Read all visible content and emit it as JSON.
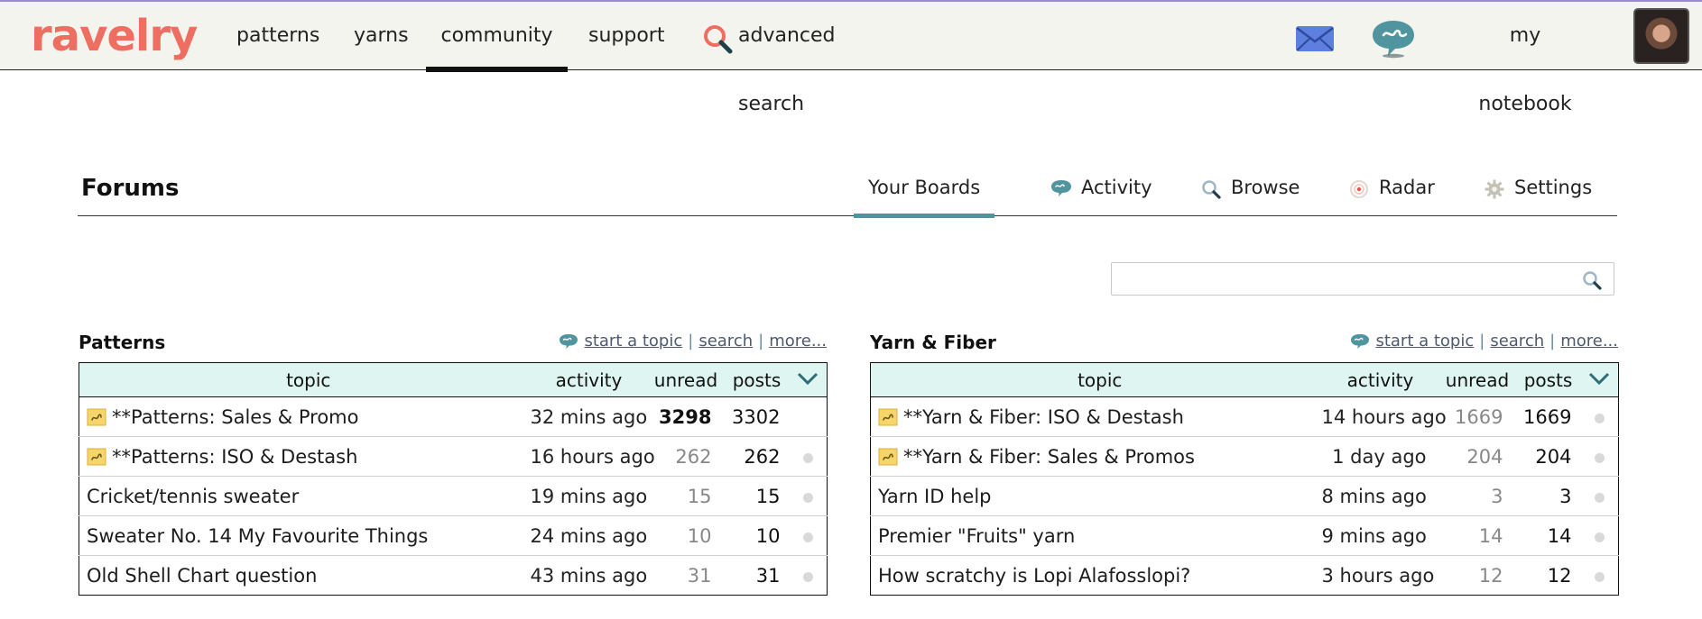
{
  "app": {
    "logo": "ravelry"
  },
  "nav": {
    "items": [
      "patterns",
      "yarns",
      "community",
      "support"
    ],
    "active": "community",
    "advanced_search": "advanced search",
    "notebook": "my notebook"
  },
  "forums": {
    "title": "Forums",
    "tabs": {
      "your_boards": "Your Boards",
      "activity": "Activity",
      "browse": "Browse",
      "radar": "Radar",
      "settings": "Settings"
    },
    "search_value": ""
  },
  "boards": [
    {
      "title": "Patterns",
      "links": {
        "start": "start a topic",
        "search": "search",
        "more": "more..."
      },
      "columns": {
        "topic": "topic",
        "activity": "activity",
        "unread": "unread",
        "posts": "posts"
      },
      "rows": [
        {
          "sticky": true,
          "topic": "**Patterns: Sales & Promo",
          "activity": "32 mins ago",
          "unread": "3298",
          "posts": "3302",
          "bold": true,
          "dot": false
        },
        {
          "sticky": true,
          "topic": "**Patterns: ISO & Destash",
          "activity": "16 hours ago",
          "unread": "262",
          "posts": "262",
          "bold": false,
          "dot": true
        },
        {
          "sticky": false,
          "topic": "Cricket/tennis sweater",
          "activity": "19 mins ago",
          "unread": "15",
          "posts": "15",
          "bold": false,
          "dot": true
        },
        {
          "sticky": false,
          "topic": "Sweater No. 14 My Favourite Things",
          "activity": "24 mins ago",
          "unread": "10",
          "posts": "10",
          "bold": false,
          "dot": true
        },
        {
          "sticky": false,
          "topic": "Old Shell Chart question",
          "activity": "43 mins ago",
          "unread": "31",
          "posts": "31",
          "bold": false,
          "dot": true
        }
      ]
    },
    {
      "title": "Yarn & Fiber",
      "links": {
        "start": "start a topic",
        "search": "search",
        "more": "more..."
      },
      "columns": {
        "topic": "topic",
        "activity": "activity",
        "unread": "unread",
        "posts": "posts"
      },
      "rows": [
        {
          "sticky": true,
          "topic": "**Yarn & Fiber: ISO & Destash",
          "activity": "14 hours ago",
          "unread": "1669",
          "posts": "1669",
          "bold": false,
          "dot": true
        },
        {
          "sticky": true,
          "topic": "**Yarn & Fiber: Sales & Promos",
          "activity": "1 day ago",
          "unread": "204",
          "posts": "204",
          "bold": false,
          "dot": true
        },
        {
          "sticky": false,
          "topic": "Yarn ID help",
          "activity": "8 mins ago",
          "unread": "3",
          "posts": "3",
          "bold": false,
          "dot": true
        },
        {
          "sticky": false,
          "topic": "Premier \"Fruits\" yarn",
          "activity": "9 mins ago",
          "unread": "14",
          "posts": "14",
          "bold": false,
          "dot": true
        },
        {
          "sticky": false,
          "topic": "How scratchy is Lopi Alafosslopi?",
          "activity": "3 hours ago",
          "unread": "12",
          "posts": "12",
          "bold": false,
          "dot": true
        }
      ]
    }
  ],
  "colors": {
    "brand": "#ee6e62",
    "tab_accent": "#4f949f",
    "table_header": "#dff5f1"
  }
}
